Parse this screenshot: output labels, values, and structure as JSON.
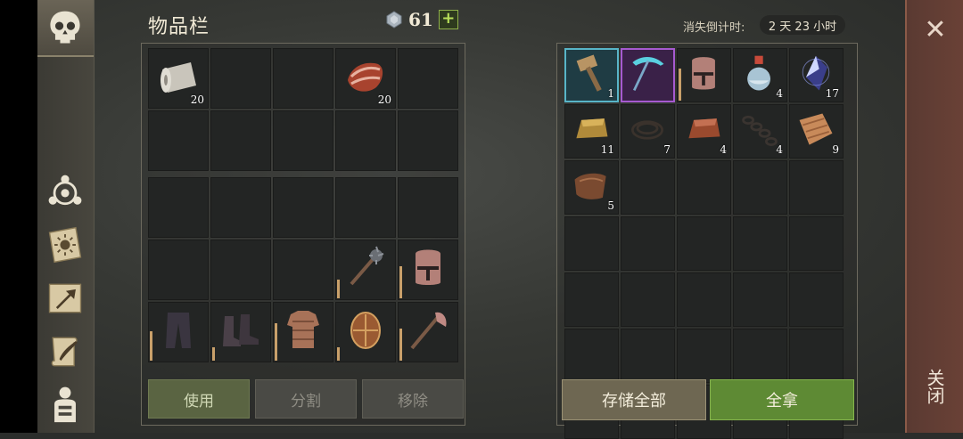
{
  "inventory": {
    "title": "物品栏",
    "currency_value": "61",
    "currency_add": "+",
    "top_cells": [
      {
        "icon": "cloth-roll-icon",
        "count": "20"
      },
      {
        "icon": "",
        "count": ""
      },
      {
        "icon": "",
        "count": ""
      },
      {
        "icon": "raw-meat-icon",
        "count": "20"
      },
      {
        "icon": "",
        "count": ""
      },
      {
        "icon": "",
        "count": ""
      },
      {
        "icon": "",
        "count": ""
      },
      {
        "icon": "",
        "count": ""
      },
      {
        "icon": "",
        "count": ""
      },
      {
        "icon": "",
        "count": ""
      }
    ],
    "equip_cells": [
      {
        "icon": "",
        "count": ""
      },
      {
        "icon": "",
        "count": ""
      },
      {
        "icon": "",
        "count": ""
      },
      {
        "icon": "",
        "count": ""
      },
      {
        "icon": "",
        "count": ""
      },
      {
        "icon": "",
        "count": ""
      },
      {
        "icon": "",
        "count": ""
      },
      {
        "icon": "",
        "count": ""
      },
      {
        "icon": "mace-icon",
        "count": "",
        "durability": 0.35
      },
      {
        "icon": "helmet-icon",
        "count": "",
        "durability": 0.6
      },
      {
        "icon": "pants-icon",
        "count": "",
        "durability": 0.55
      },
      {
        "icon": "boots-icon",
        "count": "",
        "durability": 0.25
      },
      {
        "icon": "chainmail-icon",
        "count": "",
        "durability": 0.7
      },
      {
        "icon": "shield-icon",
        "count": "",
        "durability": 0.25
      },
      {
        "icon": "axe-icon",
        "count": "",
        "durability": 0.6
      }
    ],
    "buttons": {
      "use": "使用",
      "split": "分割",
      "remove": "移除"
    }
  },
  "storage": {
    "countdown_label": "消失倒计时:",
    "countdown_value": "2 天 23 小时",
    "cells": [
      {
        "icon": "hammer-icon",
        "count": "1",
        "highlight": "blue"
      },
      {
        "icon": "pickaxe-icon",
        "count": "",
        "highlight": "purple"
      },
      {
        "icon": "helmet-icon",
        "count": "",
        "durability": 0.6
      },
      {
        "icon": "potion-icon",
        "count": "4"
      },
      {
        "icon": "crystal-icon",
        "count": "17"
      },
      {
        "icon": "gold-ingot-icon",
        "count": "11"
      },
      {
        "icon": "rope-icon",
        "count": "7"
      },
      {
        "icon": "copper-ingot-icon",
        "count": "4"
      },
      {
        "icon": "chain-icon",
        "count": "4"
      },
      {
        "icon": "fabric-icon",
        "count": "9"
      },
      {
        "icon": "leather-icon",
        "count": "5"
      },
      {
        "icon": "",
        "count": ""
      },
      {
        "icon": "",
        "count": ""
      },
      {
        "icon": "",
        "count": ""
      },
      {
        "icon": "",
        "count": ""
      },
      {
        "icon": "",
        "count": ""
      },
      {
        "icon": "",
        "count": ""
      },
      {
        "icon": "",
        "count": ""
      },
      {
        "icon": "",
        "count": ""
      },
      {
        "icon": "",
        "count": ""
      },
      {
        "icon": "",
        "count": ""
      },
      {
        "icon": "",
        "count": ""
      },
      {
        "icon": "",
        "count": ""
      },
      {
        "icon": "",
        "count": ""
      },
      {
        "icon": "",
        "count": ""
      },
      {
        "icon": "",
        "count": ""
      },
      {
        "icon": "",
        "count": ""
      },
      {
        "icon": "",
        "count": ""
      },
      {
        "icon": "",
        "count": ""
      },
      {
        "icon": "",
        "count": ""
      },
      {
        "icon": "",
        "count": ""
      },
      {
        "icon": "",
        "count": ""
      },
      {
        "icon": "",
        "count": ""
      },
      {
        "icon": "",
        "count": ""
      },
      {
        "icon": "",
        "count": ""
      }
    ],
    "buttons": {
      "store_all": "存储全部",
      "take_all": "全拿"
    }
  },
  "close": {
    "label": "关闭"
  },
  "sidebar": {
    "items": [
      {
        "icon": "skull-icon"
      },
      {
        "icon": "clan-icon"
      },
      {
        "icon": "sun-book-icon"
      },
      {
        "icon": "map-arrow-icon"
      },
      {
        "icon": "scroll-quill-icon"
      },
      {
        "icon": "character-icon"
      }
    ]
  }
}
